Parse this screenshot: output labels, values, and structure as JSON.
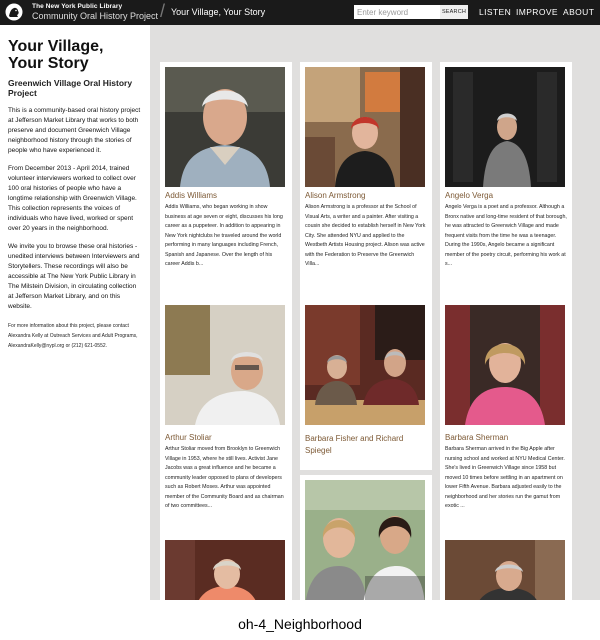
{
  "header": {
    "brand_top": "The New York Public Library",
    "brand_bottom": "Community Oral History Project",
    "breadcrumb": "Your Village, Your Story",
    "search_placeholder": "Enter keyword",
    "search_button": "SEARCH",
    "nav": [
      "LISTEN",
      "IMPROVE",
      "ABOUT"
    ]
  },
  "sidebar": {
    "title": "Your Village, Your Story",
    "subtitle": "Greenwich Village Oral History Project",
    "paragraphs": [
      "This is a community-based oral history project at Jefferson Market Library that works to both preserve and document Greenwich Village neighborhood history through the stories of people who have experienced it.",
      "From December 2013 - April 2014, trained volunteer interviewers worked to collect over 100 oral histories of people who have a longtime relationship with Greenwich Village. This collection represents the voices of individuals who have lived, worked or spent over 20 years in the neighborhood.",
      "We invite you to browse these oral histories - unedited interviews between Interviewers and Storytellers. These recordings will also be accessible at The New York Public Library in The Milstein Division, in circulating collection at Jefferson Market Library, and on this website."
    ],
    "contact": "For more information about this project, please contact Alexandra Kelly at Outreach Services and Adult Programs, AlexandraKelly@nypl.org or (212) 621-0552."
  },
  "cards": [
    {
      "name": "Addis Williams",
      "desc": "Addis Williams, who began working in show business at age seven or eight, discusses his long career as a puppeteer. In addition to appearing in New York nightclubs he traveled around the world performing in many languages including French, Spanish and Japanese. Over the length of his career Addis b..."
    },
    {
      "name": "Alison Armstrong",
      "desc": "Alison Armstrong is a professor at the School of Visual Arts, a writer and a painter. After visiting a cousin she decided to establish herself in New York City. She attended NYU and applied to the Westbeth Artists Housing project. Alison was active with the Federation to Preserve the Greenwich Villa..."
    },
    {
      "name": "Angelo Verga",
      "desc": "Angelo Verga is a poet and a professor. Although a Bronx native and long-time resident of that borough, he was attracted to Greenwich Village and made frequent visits from the time he was a teenager. During the 1990s, Angelo became a significant member of the poetry circuit, performing his work at s..."
    },
    {
      "name": "Arthur Stoliar",
      "desc": "Arthur Stoliar moved from Brooklyn to Greenwich Village in 1953, where he still lives. Activist Jane Jacobs was a great influence and he became a community leader opposed to plans of developers such as Robert Moses. Arthur was appointed member of the Community Board and as chairman of two committees..."
    },
    {
      "name": "Barbara Fisher and Richard Spiegel",
      "desc": ""
    },
    {
      "name": "Barbara Sherman",
      "desc": "Barbara Sherman arrived in the Big Apple after nursing school and worked at NYU Medical Center. She's lived in Greenwich Village since 1958 but moved 10 times before settling in an apartment on lower Fifth Avenue. Barbara adjusted easily to the neighborhood and her stories run the gamut from exotic ..."
    }
  ],
  "caption": "oh-4_Neighborhood"
}
